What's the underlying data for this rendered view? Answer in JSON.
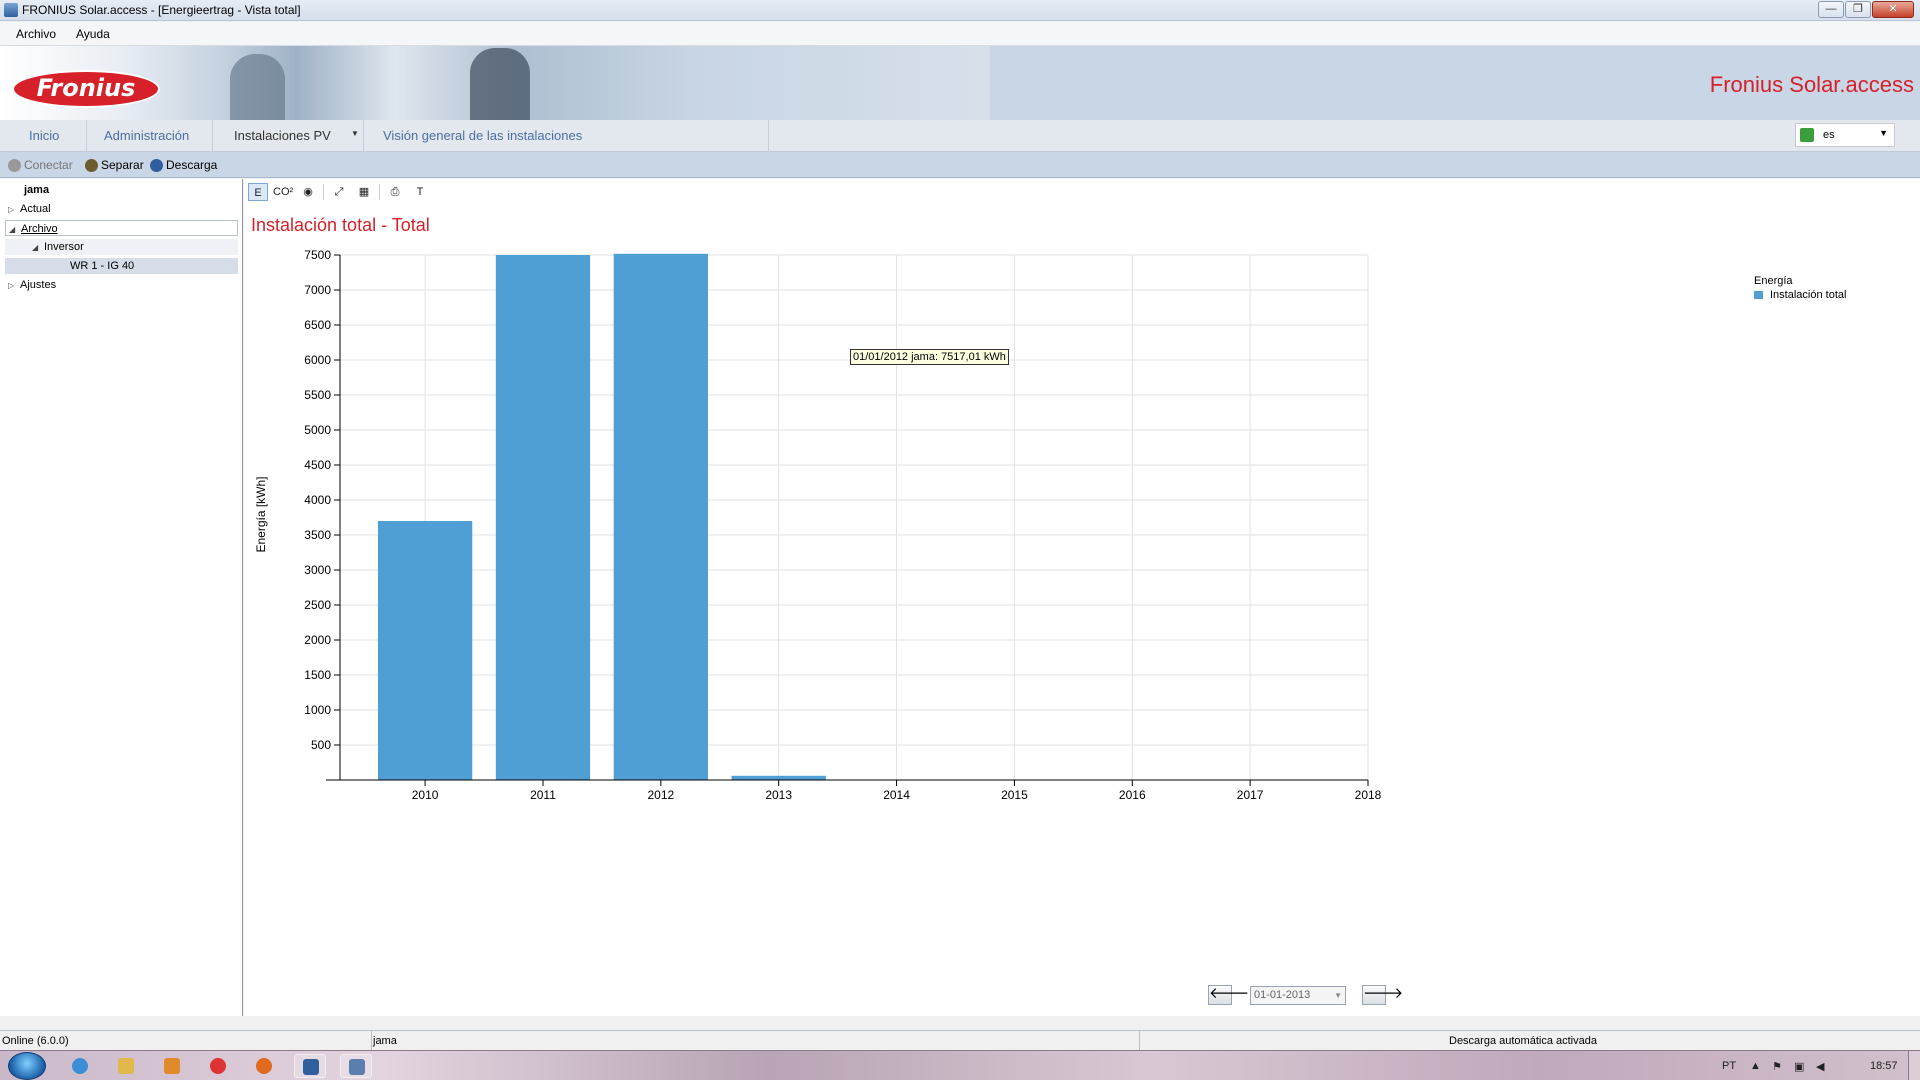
{
  "window": {
    "title": "FRONIUS Solar.access - [Energieertrag - Vista total]",
    "buttons": {
      "minimize": "—",
      "maximize": "❐",
      "close": "✕"
    }
  },
  "menu": {
    "items": [
      "Archivo",
      "Ayuda"
    ]
  },
  "banner": {
    "logo_text": "Fronius",
    "brand_title": "Fronius Solar.access"
  },
  "nav": {
    "tabs": [
      "Inicio",
      "Administración",
      "Instalaciones PV",
      "Visión general de las instalaciones"
    ],
    "active_tab": "Instalaciones PV",
    "language": "es"
  },
  "toolbar": {
    "connect": "Conectar",
    "disconnect": "Separar",
    "download": "Descarga"
  },
  "tree": {
    "root": "jama",
    "items": [
      {
        "label": "Actual",
        "expander": "▷"
      },
      {
        "label": "Archivo",
        "expander": "◢"
      },
      {
        "label": "Inversor",
        "expander": "◢"
      },
      {
        "label": "WR 1 - IG 40",
        "expander": ""
      },
      {
        "label": "Ajustes",
        "expander": "▷"
      }
    ]
  },
  "chart_tools": [
    "E",
    "CO²",
    "◉",
    "⤢",
    "▦",
    "⎙",
    "T"
  ],
  "chart_data": {
    "type": "bar",
    "title": "Instalación total - Total",
    "ylabel": "Energía [kWh]",
    "xlabel": "",
    "categories": [
      "2010",
      "2011",
      "2012",
      "2013",
      "2014",
      "2015",
      "2016",
      "2017",
      "2018"
    ],
    "series": [
      {
        "name": "Instalación total",
        "values": [
          3700,
          7500,
          7517.01,
          60,
          0,
          0,
          0,
          0,
          null
        ]
      }
    ],
    "ylim": [
      0,
      7500
    ],
    "yticks": [
      500,
      1000,
      1500,
      2000,
      2500,
      3000,
      3500,
      4000,
      4500,
      5000,
      5500,
      6000,
      6500,
      7000,
      7500
    ],
    "grid": true,
    "legend_title": "Energía",
    "legend_position": "top-right",
    "bar_color": "#4f9fd4",
    "tooltip": "01/01/2012 jama: 7517,01 kWh"
  },
  "date_nav": {
    "prev": "🡐",
    "next": "🡒",
    "date": "01-01-2013"
  },
  "status": {
    "left": "Online (6.0.0)",
    "middle": "jama",
    "right": "Descarga automática activada"
  },
  "taskbar": {
    "tray_lang": "PT",
    "clock": "18:57"
  }
}
